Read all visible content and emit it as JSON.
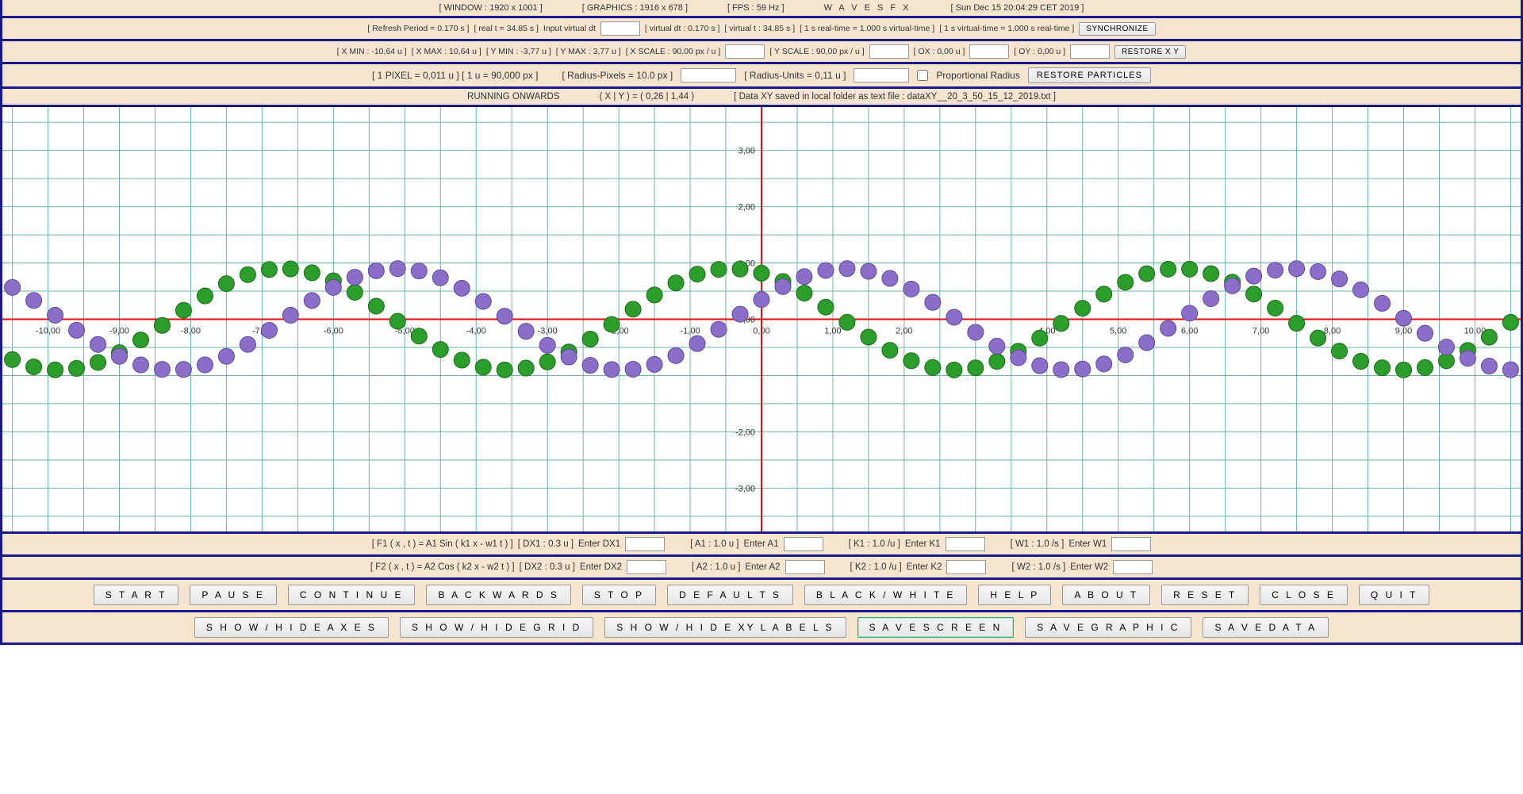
{
  "header": {
    "window": "[ WINDOW : 1920 x 1001 ]",
    "graphics": "[ GRAPHICS : 1916 x 678 ]",
    "fps": "[ FPS : 59 Hz ]",
    "title": "W  A  V  E  S      F X",
    "datetime": "[ Sun Dec 15 20:04:29 CET 2019 ]"
  },
  "timing": {
    "refresh": "[ Refresh Period = 0.170 s ]",
    "real_t": "[ real t = 34.85 s ]",
    "input_dt": "Input virtual dt",
    "virtual_dt": "[ virtual dt : 0.170 s ]",
    "virtual_t": "[ virtual t : 34.85 s ]",
    "ratio1": "[ 1 s real-time = 1.000 s virtual-time ]",
    "ratio2": "[ 1 s virtual-time = 1.000 s real-time ]",
    "sync_btn": "SYNCHRONIZE"
  },
  "axes": {
    "xmin": "[ X MIN : -10,64 u ]",
    "xmax": "[ X MAX : 10,64 u ]",
    "ymin": "[ Y MIN : -3,77 u ]",
    "ymax": "[ Y MAX : 3,77 u ]",
    "xscale": "[ X SCALE : 90,00 px / u ]",
    "yscale": "[ Y SCALE : 90,00 px / u ]",
    "ox": "[ OX : 0,00 u ]",
    "oy": "[ OY : 0,00 u ]",
    "restore": "RESTORE  X Y"
  },
  "particles": {
    "pixel_info": "[ 1 PIXEL = 0,011 u ] [ 1 u = 90,000 px ]",
    "radius_px": "[ Radius-Pixels = 10.0 px ]",
    "radius_u": "[ Radius-Units = 0,11 u ]",
    "prop_label": "Proportional Radius",
    "restore": "RESTORE  PARTICLES"
  },
  "status": {
    "running": "RUNNING ONWARDS",
    "xy": "( X | Y )  =  ( 0,26 | 1,44 )",
    "saved": "[ Data XY saved in local folder as text file : dataXY__20_3_50_15_12_2019.txt ]"
  },
  "chart_data": {
    "type": "scatter",
    "xlim": [
      -10.64,
      10.64
    ],
    "ylim": [
      -3.77,
      3.77
    ],
    "xticks": [
      -10,
      -9,
      -8,
      -7,
      -6,
      -5,
      -4,
      -3,
      -2,
      -1,
      0,
      1,
      2,
      3,
      4,
      5,
      6,
      7,
      8,
      9,
      10
    ],
    "yticks": [
      -3,
      -2,
      0,
      1,
      2,
      3
    ],
    "xtick_labels": [
      "-10,00",
      "-9,00",
      "-8,00",
      "-7,00",
      "-6,00",
      "-5,00",
      "-4,00",
      "-3,00",
      "-2,00",
      "-1,00",
      "0,00",
      "1,00",
      "2,00",
      "3,00",
      "4,00",
      "5,00",
      "6,00",
      "7,00",
      "8,00",
      "9,00",
      "10,00"
    ],
    "ytick_labels": [
      "-3,00",
      "-2,00",
      "0,00",
      "1,00",
      "2,00",
      "3,00"
    ],
    "radius_px": 10,
    "series": [
      {
        "name": "F1_sin_green",
        "dx": 0.3,
        "x0": -10.5,
        "amplitude": 0.9,
        "period": 6.28,
        "phase": 2.0,
        "yoffset": 0.0,
        "color": "green"
      },
      {
        "name": "F2_cos_purple",
        "dx": 0.3,
        "x0": -10.5,
        "amplitude": 0.9,
        "period": 6.28,
        "phase": 0.4,
        "yoffset": 0.0,
        "color": "purple"
      }
    ]
  },
  "f1": {
    "eq": "[ F1 ( x , t ) = A1 Sin ( k1 x - w1 t ) ]",
    "dx": "[ DX1 : 0.3 u ]",
    "enter_dx": "Enter DX1",
    "a": "[ A1 : 1.0 u ]",
    "enter_a": "Enter A1",
    "k": "[ K1 : 1.0 /u ]",
    "enter_k": "Enter K1",
    "w": "[ W1 : 1.0 /s ]",
    "enter_w": "Enter W1"
  },
  "f2": {
    "eq": "[ F2 ( x , t ) = A2 Cos ( k2 x - w2 t ) ]",
    "dx": "[ DX2 : 0.3 u ]",
    "enter_dx": "Enter DX2",
    "a": "[ A2 : 1.0 u ]",
    "enter_a": "Enter A2",
    "k": "[ K2 : 1.0 /u ]",
    "enter_k": "Enter K2",
    "w": "[ W2 : 1.0 /s ]",
    "enter_w": "Enter W2"
  },
  "controls1": {
    "start": "S T A R T",
    "pause": "P A U S E",
    "continue": "C O N T I N U E",
    "backwards": "B A C K W A R D S",
    "stop": "S T O P",
    "defaults": "D E F A U L T S",
    "bw": "B L A C K / W H I T E",
    "help": "H E L P",
    "about": "A B O U T",
    "reset": "R E S E T",
    "close": "C L O S E",
    "quit": "Q U I T"
  },
  "controls2": {
    "axes": "S H O W / H I D E  A X E S",
    "grid": "S H O W / H I D E  G R I D",
    "labels": "S H O W / H I D E  XY  L A B E L S",
    "save_screen": "S A V E  S C R E E N",
    "save_graphic": "S A V E  G R A P H I C",
    "save_data": "S A V E  D A T A"
  }
}
